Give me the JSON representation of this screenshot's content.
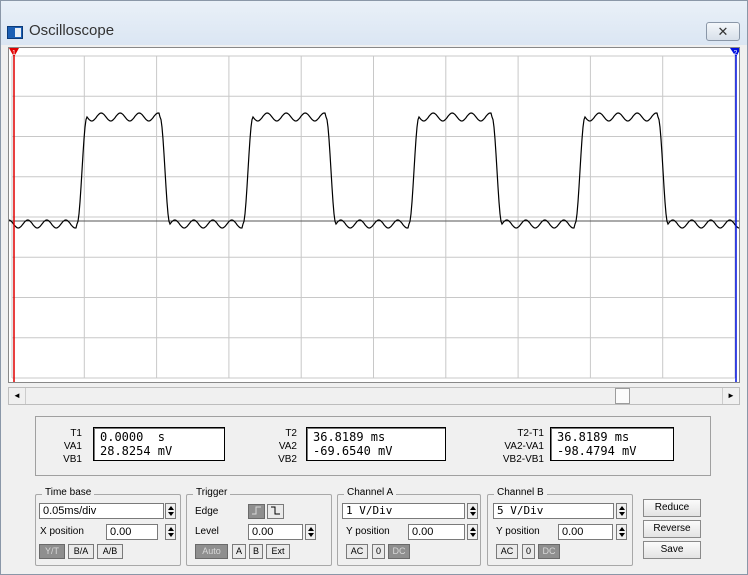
{
  "window": {
    "title": "Oscilloscope",
    "close_glyph": "✕"
  },
  "screen": {
    "cursor1_label": "1",
    "cursor2_label": "2",
    "cursor1_color": "#e00000",
    "cursor2_color": "#0010e0",
    "grid_color": "#c8c8c8",
    "trace_color": "#000000",
    "background": "#ffffff"
  },
  "scrollbar": {
    "left_arrow": "◄",
    "right_arrow": "►"
  },
  "readout": {
    "T1": {
      "label": "T1",
      "VA1_label": "VA1",
      "VB1_label": "VB1",
      "time": "0.0000  s",
      "va": "28.8254 mV"
    },
    "T2": {
      "label": "T2",
      "VA2_label": "VA2",
      "VB2_label": "VB2",
      "time": "36.8189 ms",
      "va": "-69.6540 mV"
    },
    "diff": {
      "label": "T2-T1",
      "va_label": "VA2-VA1",
      "vb_label": "VB2-VB1",
      "time": "36.8189 ms",
      "va": "-98.4794 mV"
    }
  },
  "timebase": {
    "title": "Time base",
    "scale": "0.05ms/div",
    "xpos_label": "X position",
    "xpos_value": "0.00",
    "modes": [
      "Y/T",
      "B/A",
      "A/B"
    ],
    "active_mode": "Y/T"
  },
  "trigger": {
    "title": "Trigger",
    "edge_label": "Edge",
    "level_label": "Level",
    "level_value": "0.00",
    "edge_rising_icon": "rising-edge-icon",
    "edge_falling_icon": "falling-edge-icon",
    "sources": [
      "Auto",
      "A",
      "B",
      "Ext"
    ],
    "active_source": "Auto"
  },
  "channel_a": {
    "title": "Channel A",
    "scale": "1 V/Div",
    "ypos_label": "Y position",
    "ypos_value": "0.00",
    "coupling": [
      "AC",
      "0",
      "DC"
    ],
    "active_coupling": "DC"
  },
  "channel_b": {
    "title": "Channel B",
    "scale": "5 V/Div",
    "ypos_label": "Y position",
    "ypos_value": "0.00",
    "coupling": [
      "AC",
      "0",
      "DC"
    ],
    "active_coupling": "DC"
  },
  "buttons": {
    "reduce": "Reduce",
    "reverse": "Reverse",
    "save": "Save"
  }
}
